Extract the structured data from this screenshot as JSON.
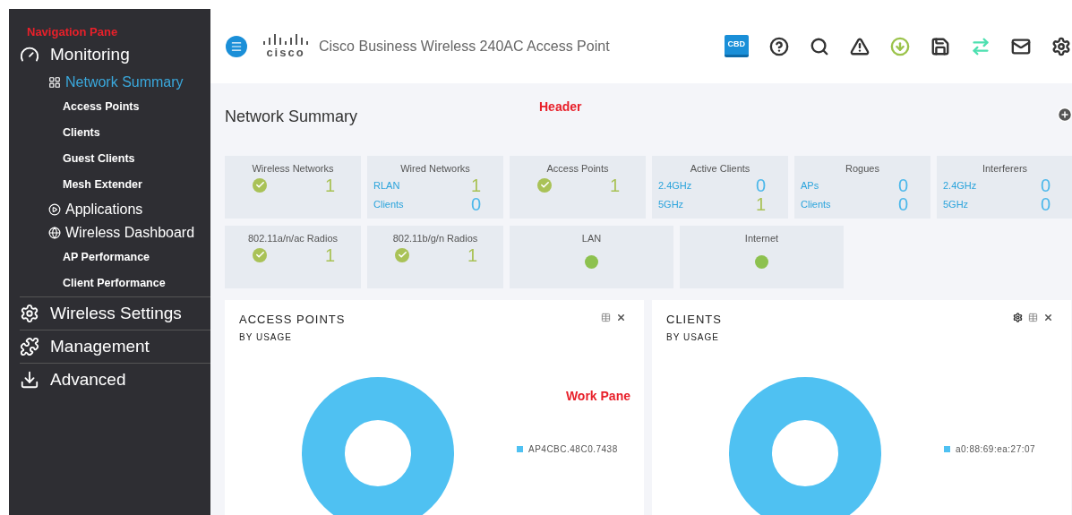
{
  "annotations": {
    "navigation": "Navigation Pane",
    "header": "Header",
    "work": "Work Pane"
  },
  "sidebar": {
    "items": [
      {
        "label": "Monitoring",
        "kind": "dashboard",
        "expanded": true,
        "children": [
          {
            "label": "Network Summary",
            "kind": "grid",
            "selected": true,
            "children": [
              {
                "label": "Access Points",
                "selected": false
              },
              {
                "label": "Clients",
                "selected": false
              },
              {
                "label": "Guest Clients",
                "selected": false
              },
              {
                "label": "Mesh Extender",
                "selected": false
              }
            ]
          },
          {
            "label": "Applications",
            "kind": "play",
            "selected": false
          },
          {
            "label": "Wireless Dashboard",
            "kind": "globe",
            "selected": false,
            "children": [
              {
                "label": "AP Performance",
                "selected": false
              },
              {
                "label": "Client Performance",
                "selected": false
              }
            ]
          }
        ]
      },
      {
        "label": "Wireless Settings",
        "kind": "gear"
      },
      {
        "label": "Management",
        "kind": "puzzle"
      },
      {
        "label": "Advanced",
        "kind": "download"
      }
    ]
  },
  "header": {
    "logo": "cisco",
    "title": "Cisco Business Wireless 240AC Access Point",
    "badge": "CBD"
  },
  "page": {
    "title": "Network Summary"
  },
  "tiles": [
    {
      "title": "Wireless Networks",
      "kind": "check",
      "value": "1",
      "color": "#a9c257"
    },
    {
      "title": "Wired Networks",
      "kind": "pairs",
      "rows": [
        {
          "label": "RLAN",
          "value": "1",
          "color": "#a9c257"
        },
        {
          "label": "Clients",
          "value": "0",
          "color": "#4db8ea"
        }
      ]
    },
    {
      "title": "Access Points",
      "kind": "check",
      "value": "1",
      "color": "#a9c257"
    },
    {
      "title": "Active Clients",
      "kind": "pairs",
      "rows": [
        {
          "label": "2.4GHz",
          "value": "0",
          "color": "#4db8ea"
        },
        {
          "label": "5GHz",
          "value": "1",
          "color": "#a9c257"
        }
      ]
    },
    {
      "title": "Rogues",
      "kind": "pairs",
      "rows": [
        {
          "label": "APs",
          "value": "0",
          "color": "#4db8ea"
        },
        {
          "label": "Clients",
          "value": "0",
          "color": "#4db8ea"
        }
      ]
    },
    {
      "title": "Interferers",
      "kind": "pairs",
      "rows": [
        {
          "label": "2.4GHz",
          "value": "0",
          "color": "#4db8ea"
        },
        {
          "label": "5GHz",
          "value": "0",
          "color": "#4db8ea"
        }
      ]
    },
    {
      "title": "802.11a/n/ac Radios",
      "kind": "check",
      "value": "1",
      "color": "#a9c257"
    },
    {
      "title": "802.11b/g/n Radios",
      "kind": "check",
      "value": "1",
      "color": "#a9c257"
    },
    {
      "title": "LAN",
      "kind": "dot",
      "color": "#8dc14f"
    },
    {
      "title": "Internet",
      "kind": "dot",
      "color": "#8dc14f"
    }
  ],
  "panels": [
    {
      "title": "ACCESS POINTS",
      "subtitle": "BY USAGE",
      "legend": [
        {
          "label": "AP4CBC.48C0.7438",
          "color": "#4fc1f2"
        }
      ]
    },
    {
      "title": "CLIENTS",
      "subtitle": "BY USAGE",
      "settings": true,
      "legend": [
        {
          "label": "a0:88:69:ea:27:07",
          "color": "#4fc1f2"
        }
      ]
    }
  ]
}
